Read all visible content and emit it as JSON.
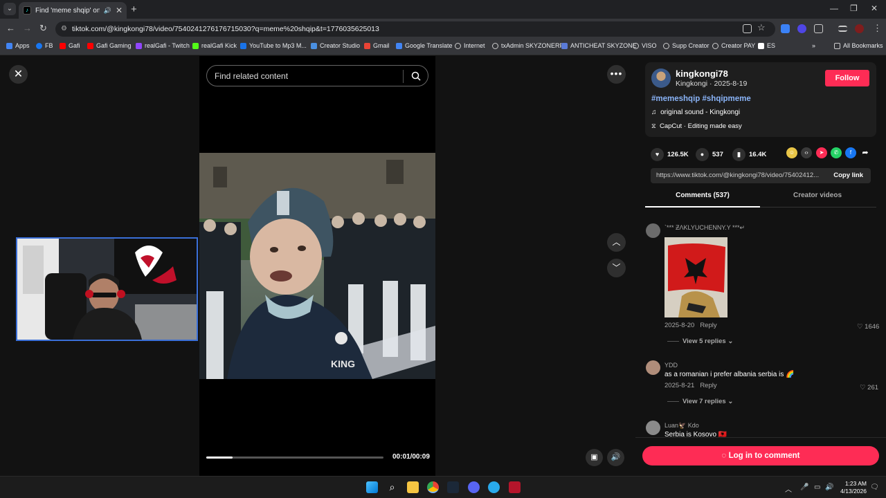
{
  "browser": {
    "tab_title": "Find 'meme shqip' on TikTo",
    "url": "tiktok.com/@kingkongi78/video/7540241276176715030?q=meme%20shqip&t=1776035625013"
  },
  "bookmarks": [
    {
      "label": "Apps",
      "color": "#4285f4"
    },
    {
      "label": "FB",
      "color": "#1877f2"
    },
    {
      "label": "Gafi",
      "color": "#ff0000"
    },
    {
      "label": "Gafi Gaming",
      "color": "#ff0000"
    },
    {
      "label": "realGafi - Twitch",
      "color": "#9146ff"
    },
    {
      "label": "realGafi Kick",
      "color": "#53fc18"
    },
    {
      "label": "YouTube to Mp3 M...",
      "color": "#1a73e8"
    },
    {
      "label": "Creator Studio",
      "color": "#4a90e2"
    },
    {
      "label": "Gmail",
      "color": "#ea4335"
    },
    {
      "label": "Google Translate",
      "color": "#4285f4"
    },
    {
      "label": "Internet",
      "color": "#cccccc"
    },
    {
      "label": "txAdmin SKYZONERP",
      "color": "#cccccc"
    },
    {
      "label": "ANTICHEAT SKYZONE",
      "color": "#5a7bd8"
    },
    {
      "label": "VISO",
      "color": "#cccccc"
    },
    {
      "label": "Supp Creator",
      "color": "#cccccc"
    },
    {
      "label": "Creator PAY",
      "color": "#cccccc"
    },
    {
      "label": "ES",
      "color": "#ffffff"
    }
  ],
  "all_bookmarks": "All Bookmarks",
  "search": {
    "placeholder": "Find related content"
  },
  "video": {
    "time": "00:01/00:09",
    "progress_fraction": 0.15
  },
  "author": {
    "username": "kingkongi78",
    "subline": "Kingkongi · 2025-8-19",
    "follow_label": "Follow",
    "hashtags": "#memeshqip #shqipmeme",
    "sound": "original sound - Kingkongi",
    "capcut": "CapCut · Editing made easy"
  },
  "stats": {
    "likes": "126.5K",
    "comments": "537",
    "saves": "16.4K"
  },
  "link": {
    "url": "https://www.tiktok.com/@kingkongi78/video/75402412...",
    "copy_label": "Copy link"
  },
  "tabs": {
    "comments": "Comments (537)",
    "creator": "Creator videos"
  },
  "comments": [
    {
      "name": "`*** ƵΛKLYUCHENNY.Y ***↵",
      "date": "2025-8-20",
      "reply": "Reply",
      "likes": "1646",
      "replies": "View 5 replies"
    },
    {
      "name": "YDD",
      "text": "as a romanian i prefer albania serbia is 🌈",
      "date": "2025-8-21",
      "reply": "Reply",
      "likes": "261",
      "replies": "View 7 replies"
    },
    {
      "name": "Luan🦅 Kdo",
      "text": "Serbia is Kosovo 🇦🇱"
    }
  ],
  "login_label": "Log in to comment",
  "taskbar": {
    "time": "1:23 AM",
    "date": "4/13/2026"
  },
  "colors": {
    "accent": "#fe2c55",
    "hashtag": "#8ab4f8"
  }
}
